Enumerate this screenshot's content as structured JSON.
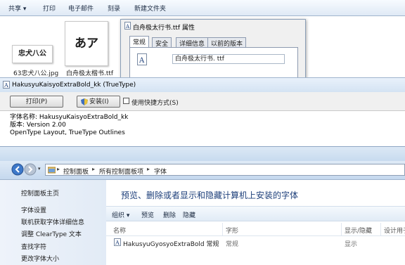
{
  "explorer": {
    "toolbar": [
      "共享 ▾",
      "打印",
      "电子邮件",
      "刻录",
      "新建文件夹"
    ],
    "files": [
      {
        "thumb_text": "忠犬八公",
        "label": "63忠犬八公.jpg"
      },
      {
        "thumb_text": "あア",
        "label": "白舟极太楷书.ttf"
      }
    ]
  },
  "properties": {
    "title": "白舟极太行书.ttf 属性",
    "tabs": [
      "常规",
      "安全",
      "详细信息",
      "以前的版本"
    ],
    "filename": "白舟极太行书. ttf"
  },
  "font_viewer": {
    "title": "HakusyuKaisyoExtraBold_kk (TrueType)",
    "print_label": "打印(P)",
    "install_label": "安装(I)",
    "shortcut_label": "使用快捷方式(S)",
    "info": [
      "字体名称: HakusyuKaisyoExtraBold_kk",
      "版本: Version 2.00",
      "OpenType Layout, TrueType Outlines"
    ]
  },
  "control_panel": {
    "breadcrumb": [
      "控制面板",
      "所有控制面板项",
      "字体"
    ],
    "sidebar": [
      "控制面板主页",
      "字体设置",
      "联机获取字体详细信息",
      "调整 ClearType 文本",
      "查找字符",
      "更改字体大小"
    ],
    "heading": "预览、删除或者显示和隐藏计算机上安装的字体",
    "commands": [
      "组织 ▾",
      "预览",
      "删除",
      "隐藏"
    ],
    "columns": [
      "名称",
      "字形",
      "显示/隐藏",
      "设计用于"
    ],
    "row": {
      "name": "HakusyuGyosyoExtraBold 常规",
      "style": "常规",
      "visibility": "显示"
    }
  },
  "colors": {
    "accent": "#1d3f7a",
    "titlebar": "#d4e3f3"
  }
}
